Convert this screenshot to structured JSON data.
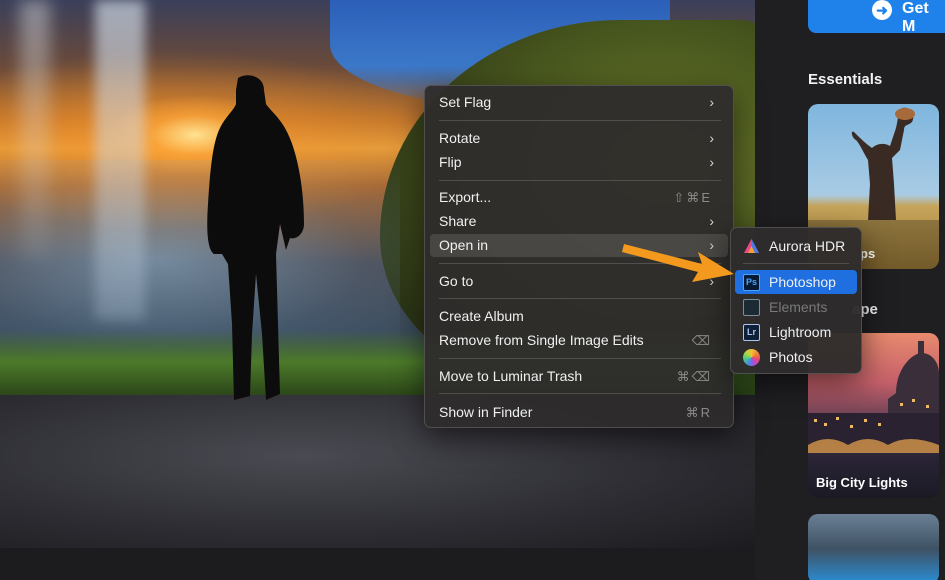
{
  "photo": {
    "subject": "person-silhouette-waterfall"
  },
  "sidebar": {
    "get_button": {
      "label": "Get M",
      "icon": "arrow-right-circle-icon"
    },
    "sections": [
      {
        "title": "Essentials"
      },
      {
        "title": "ape"
      }
    ],
    "cards": [
      {
        "caption": "ps"
      },
      {
        "caption": "Big City Lights"
      },
      {
        "caption": ""
      }
    ]
  },
  "context_menu": {
    "items": [
      {
        "label": "Set Flag",
        "submenu": true
      },
      {
        "label": "Rotate",
        "submenu": true
      },
      {
        "label": "Flip",
        "submenu": true
      },
      {
        "label": "Export...",
        "shortcut": "⇧⌘E"
      },
      {
        "label": "Share",
        "submenu": true
      },
      {
        "label": "Open in",
        "submenu": true,
        "highlighted": true
      },
      {
        "label": "Go to",
        "submenu": true
      },
      {
        "label": "Create Album"
      },
      {
        "label": "Remove from Single Image Edits",
        "shortcut": "⌫"
      },
      {
        "label": "Move to Luminar Trash",
        "shortcut": "⌘⌫"
      },
      {
        "label": "Show in Finder",
        "shortcut": "⌘R"
      }
    ]
  },
  "open_in_submenu": {
    "items": [
      {
        "label": "Aurora HDR",
        "icon": "aurora-hdr-icon"
      },
      {
        "label": "Photoshop",
        "icon": "photoshop-icon",
        "icon_text": "Ps",
        "selected": true
      },
      {
        "label": "Elements",
        "icon": "elements-icon",
        "disabled": true
      },
      {
        "label": "Lightroom",
        "icon": "lightroom-icon",
        "icon_text": "Lr"
      },
      {
        "label": "Photos",
        "icon": "photos-icon"
      }
    ]
  },
  "colors": {
    "accent": "#1f6fe0",
    "annotation_arrow": "#f39a1e",
    "get_button": "#1f82ea"
  }
}
